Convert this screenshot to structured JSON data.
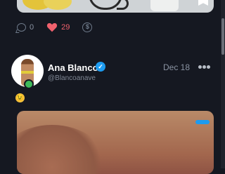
{
  "prev_post": {
    "comments_count": "0",
    "likes_count": "29"
  },
  "post": {
    "author_name": "Ana Blanco",
    "author_handle": "@Blancoanave",
    "date": "Dec 18",
    "text": "😉"
  },
  "colors": {
    "background": "#151821",
    "like": "#f0616d",
    "verified": "#1d9bf0",
    "online": "#3fba5a"
  }
}
